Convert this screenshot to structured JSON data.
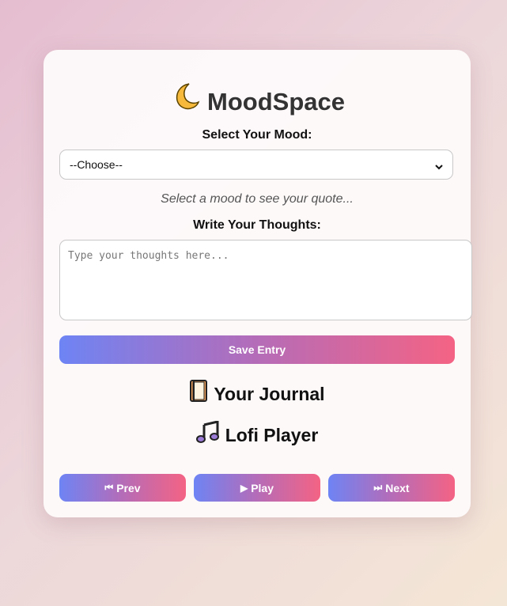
{
  "app": {
    "title": "MoodSpace",
    "title_icon": "crescent-moon-icon"
  },
  "mood": {
    "label": "Select Your Mood:",
    "selected": "--Choose--",
    "quote_placeholder": "Select a mood to see your quote..."
  },
  "thoughts": {
    "label": "Write Your Thoughts:",
    "placeholder": "Type your thoughts here..."
  },
  "save_button": {
    "label": "Save Entry"
  },
  "journal": {
    "title": "Your Journal",
    "icon": "notebook-icon"
  },
  "player": {
    "title": "Lofi Player",
    "icon": "music-note-icon",
    "prev_label": "Prev",
    "play_label": "Play",
    "next_label": "Next",
    "prev_glyph": "⏮",
    "play_glyph": "▶",
    "next_glyph": "⏭"
  },
  "colors": {
    "gradient_start": "#6e84f4",
    "gradient_end": "#f46384"
  }
}
